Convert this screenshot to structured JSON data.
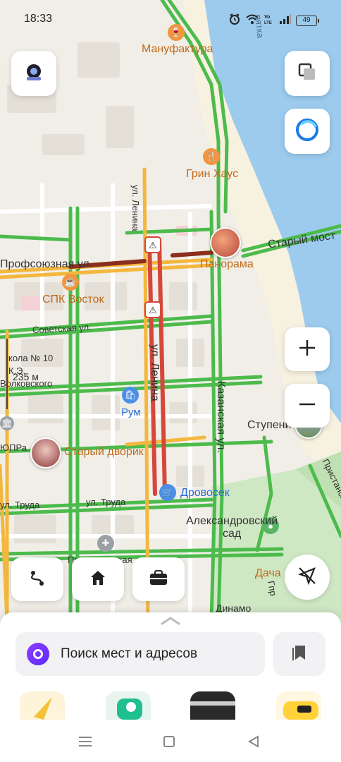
{
  "status": {
    "time": "18:33",
    "battery": "49"
  },
  "map": {
    "places": {
      "manufaktura": "Мануфактура",
      "grin_haus": "Грин Хаус",
      "panorama": "Панорама",
      "spk_vostok": "СПК Восток",
      "rum": "Рум",
      "stary_dvorik": "Старый дворик",
      "drovosek": "Дровосек",
      "aleksandrovsky_sad": "Александровский\nсад",
      "stupeni": "Ступени",
      "dacha": "Дача",
      "dinamo": "Динамо"
    },
    "streets": {
      "profsoyuznaya": "Профсоюзная ул.",
      "sovetskaya": "Советская ул.",
      "lenina_top": "ул. Ленина",
      "lenina_mid": "ул. Ленина",
      "kazanskaya": "Казанская ул.",
      "stary_most": "Старый мост",
      "truda_left": "ул. Труда",
      "truda_mid": "ул. Труда",
      "pristanskaya": "Пристанская ул.",
      "naberezhnaya": "рятка",
      "predtechenskaya": "Предтеченская",
      "volkovskogo": "Волковского",
      "school": "кола № 10",
      "ke": "К.Э.",
      "sopra": "ЮПРа",
      "gpr": "Гпр"
    },
    "scale": "235 м"
  },
  "search": {
    "placeholder": "Поиск мест и адресов"
  }
}
